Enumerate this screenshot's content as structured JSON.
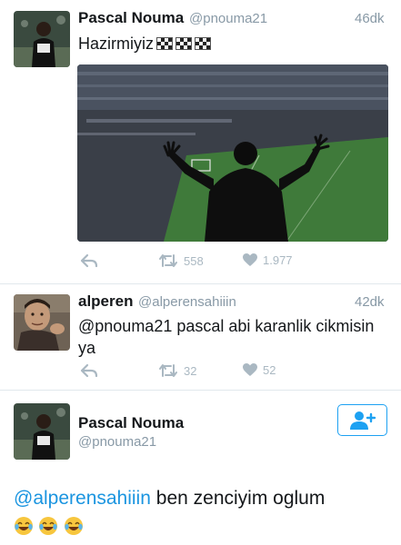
{
  "tweet1": {
    "name": "Pascal Nouma",
    "handle": "@pnouma21",
    "time": "46dk",
    "text": "Hazirmiyiz",
    "flag_icons": [
      "checkered-flag-icon",
      "checkered-flag-icon",
      "checkered-flag-icon"
    ],
    "retweets": "558",
    "likes": "1.977"
  },
  "tweet2": {
    "name": "alperen",
    "handle": "@alperensahiiin",
    "time": "42dk",
    "text_line1": "@pnouma21 pascal abi karanlik cikmisin",
    "text_line2": "ya",
    "retweets": "32",
    "likes": "52"
  },
  "tweet3": {
    "name": "Pascal Nouma",
    "handle": "@pnouma21",
    "mention": "@alperensahiiin",
    "text": "ben zenciyim oglum",
    "emoji_icons": [
      "tears-of-joy-emoji",
      "tears-of-joy-emoji",
      "tears-of-joy-emoji"
    ]
  },
  "colors": {
    "link": "#1b95e0",
    "muted": "#8899a6",
    "action_gray": "#aab8c2",
    "follow_blue": "#1da1f2",
    "divider": "#e1e8ed"
  }
}
